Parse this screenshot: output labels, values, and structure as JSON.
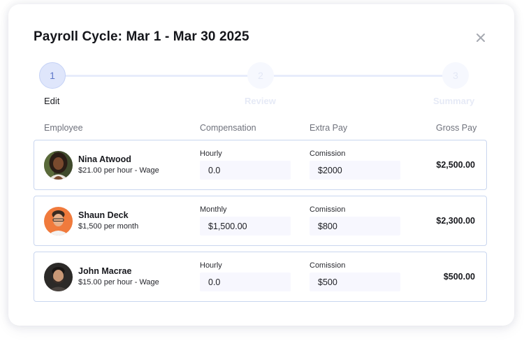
{
  "modal": {
    "title": "Payroll Cycle: Mar 1 - Mar 30 2025"
  },
  "stepper": {
    "steps": [
      {
        "number": "1",
        "label": "Edit",
        "state": "active"
      },
      {
        "number": "2",
        "label": "Review",
        "state": "inactive"
      },
      {
        "number": "3",
        "label": "Summary",
        "state": "inactive"
      }
    ]
  },
  "table": {
    "headers": {
      "employee": "Employee",
      "compensation": "Compensation",
      "extra_pay": "Extra Pay",
      "gross_pay": "Gross Pay"
    },
    "rows": [
      {
        "name": "Nina Atwood",
        "rate": "$21.00 per hour - Wage",
        "comp_type": "Hourly",
        "comp_value": "0.0",
        "extra_type": "Comission",
        "extra_value": "$2000",
        "gross": "$2,500.00"
      },
      {
        "name": "Shaun Deck",
        "rate": "$1,500 per month",
        "comp_type": "Monthly",
        "comp_value": "$1,500.00",
        "extra_type": "Comission",
        "extra_value": "$800",
        "gross": "$2,300.00"
      },
      {
        "name": "John Macrae",
        "rate": "$15.00 per hour - Wage",
        "comp_type": "Hourly",
        "comp_value": "0.0",
        "extra_type": "Comission",
        "extra_value": "$500",
        "gross": "$500.00"
      }
    ]
  },
  "colors": {
    "accent": "#5d76c9",
    "row_border": "#c9d6ef",
    "input_bg": "#f7f7fe"
  },
  "icons": {
    "close": "close-icon"
  }
}
